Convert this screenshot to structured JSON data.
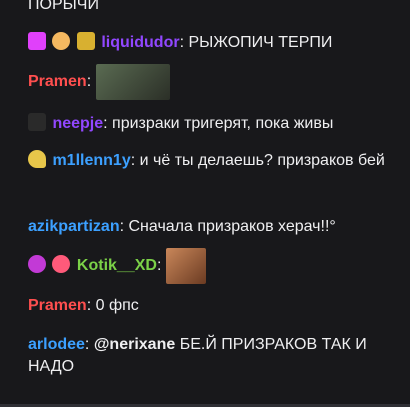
{
  "messages": [
    {
      "user": "",
      "text": "ПОРЫЧИ"
    },
    {
      "user": "liquidudor",
      "user_color": "#9147ff",
      "text": "РЫЖОПИЧ ТЕРПИ"
    },
    {
      "user": "Pramen",
      "user_color": "#ff4f4f",
      "text": ""
    },
    {
      "user": "neepje",
      "user_color": "#9147ff",
      "text": "призраки тригерят, пока живы"
    },
    {
      "user": "m1llenn1y",
      "user_color": "#3ca0ff",
      "text": "и чё ты делаешь? призраков бей"
    },
    {
      "user": "azikpartizan",
      "user_color": "#3ca0ff",
      "text": "Сначала призраков херач!!°"
    },
    {
      "user": "Kotik__XD",
      "user_color": "#7bd148",
      "text": ""
    },
    {
      "user": "Pramen",
      "user_color": "#ff4f4f",
      "text": "0 фпс"
    },
    {
      "user": "arlodee",
      "user_color": "#3ca0ff",
      "mention": "@nerixane",
      "text": "БЕ.Й ПРИЗРАКОВ ТАК И НАДО"
    }
  ],
  "colon": ":"
}
